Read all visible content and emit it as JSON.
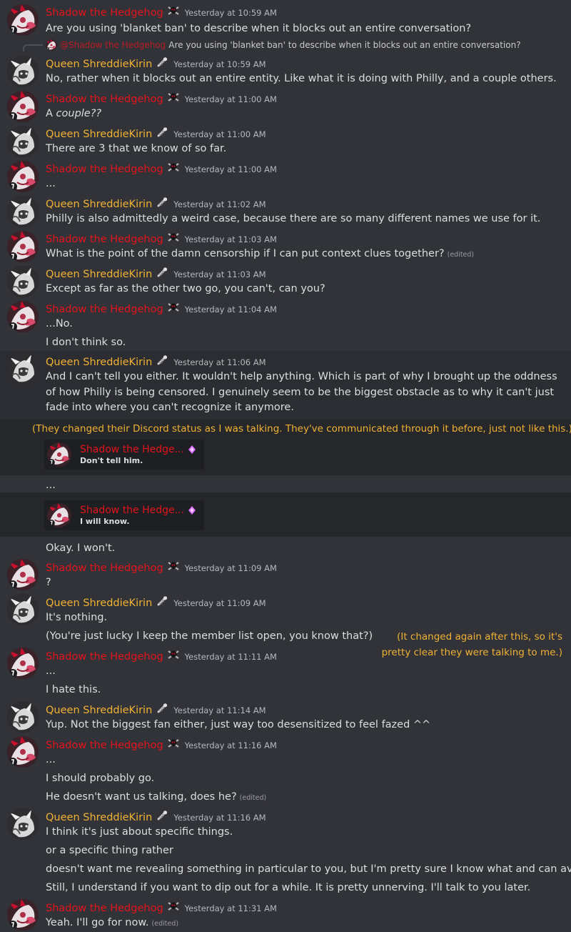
{
  "users": {
    "shadow": {
      "name": "Shadow the Hedgehog",
      "color": "#e3131b",
      "badge": "skull-crossbones-icon"
    },
    "queen": {
      "name": "Queen ShreddieKirin",
      "color": "#f0b232",
      "badge": "screw-icon"
    },
    "shadow_truncated": "Shadow the Hedge..."
  },
  "reply": {
    "mention": "@Shadow the Hedgehog",
    "text": "Are you using 'blanket ban' to describe when it blocks out an entire conversation?"
  },
  "edited_label": "(edited)",
  "messages": [
    {
      "user": "shadow",
      "time": "Yesterday at 10:59 AM",
      "lines": [
        "Are you using 'blanket ban' to describe when it blocks out an entire conversation?"
      ]
    },
    {
      "user": "queen",
      "time": "Yesterday at 10:59 AM",
      "lines": [
        "No, rather when it blocks out an entire entity. Like what it is doing with Philly, and a couple others."
      ]
    },
    {
      "user": "shadow",
      "time": "Yesterday at 11:00 AM",
      "lines": [
        "A ",
        "couple??"
      ]
    },
    {
      "user": "queen",
      "time": "Yesterday at 11:00 AM",
      "lines": [
        "There are 3 that we know of so far."
      ]
    },
    {
      "user": "shadow",
      "time": "Yesterday at 11:00 AM",
      "lines": [
        "..."
      ]
    },
    {
      "user": "queen",
      "time": "Yesterday at 11:02 AM",
      "lines": [
        "Philly is also admittedly a weird case, because there are so many different names we use for it."
      ]
    },
    {
      "user": "shadow",
      "time": "Yesterday at 11:03 AM",
      "lines": [
        "What is the point of the damn censorship if I can put context clues together?"
      ]
    },
    {
      "user": "queen",
      "time": "Yesterday at 11:03 AM",
      "lines": [
        "Except as far as the other two go, you can't, can you?"
      ]
    },
    {
      "user": "shadow",
      "time": "Yesterday at 11:04 AM",
      "lines": [
        "...No.",
        "I don't think so."
      ]
    },
    {
      "user": "queen",
      "time": "Yesterday at 11:06 AM",
      "lines": [
        "And I can't tell you either. It wouldn't help anything. Which is part of why I brought up the oddness of how Philly is being censored. I genuinely seem to be the biggest obstacle as to why it can't just fade into where you can't recognize it anymore."
      ]
    },
    {
      "user": "queen",
      "time": "",
      "lines": [
        "...",
        "Okay. I won't."
      ]
    },
    {
      "user": "shadow",
      "time": "Yesterday at 11:09 AM",
      "lines": [
        "?"
      ]
    },
    {
      "user": "queen",
      "time": "Yesterday at 11:09 AM",
      "lines": [
        "It's nothing.",
        "(You're just lucky I keep the member list open, you know that?)"
      ]
    },
    {
      "user": "shadow",
      "time": "Yesterday at 11:11 AM",
      "lines": [
        "...",
        "I hate this."
      ]
    },
    {
      "user": "queen",
      "time": "Yesterday at 11:14 AM",
      "lines": [
        "Yup. Not the biggest fan either, just way too desensitized to feel fazed ^^"
      ]
    },
    {
      "user": "shadow",
      "time": "Yesterday at 11:16 AM",
      "lines": [
        "...",
        "I should probably go.",
        "He doesn't want us talking, does he?"
      ]
    },
    {
      "user": "queen",
      "time": "Yesterday at 11:16 AM",
      "lines": [
        "I think it's just about specific things.",
        "or a specific thing rather",
        "doesn't want me revealing something in particular to you, but I'm pretty sure I know what and can avoid it",
        "Still, I understand if you want to dip out for a while. It is pretty unnerving. I'll talk to you later."
      ]
    },
    {
      "user": "shadow",
      "time": "Yesterday at 11:31 AM",
      "lines": [
        "Yeah. I'll go for now."
      ]
    }
  ],
  "notes": {
    "status_note": "(They changed their Discord status as I was talking. They've communicated through it before, just not like this.)",
    "side_note": "(It changed again after this, so it's pretty clear they were talking to me.)"
  },
  "status_cards": [
    {
      "name": "Shadow the Hedge...",
      "text": "Don't tell him."
    },
    {
      "name": "Shadow the Hedge...",
      "text": "I will know."
    }
  ]
}
